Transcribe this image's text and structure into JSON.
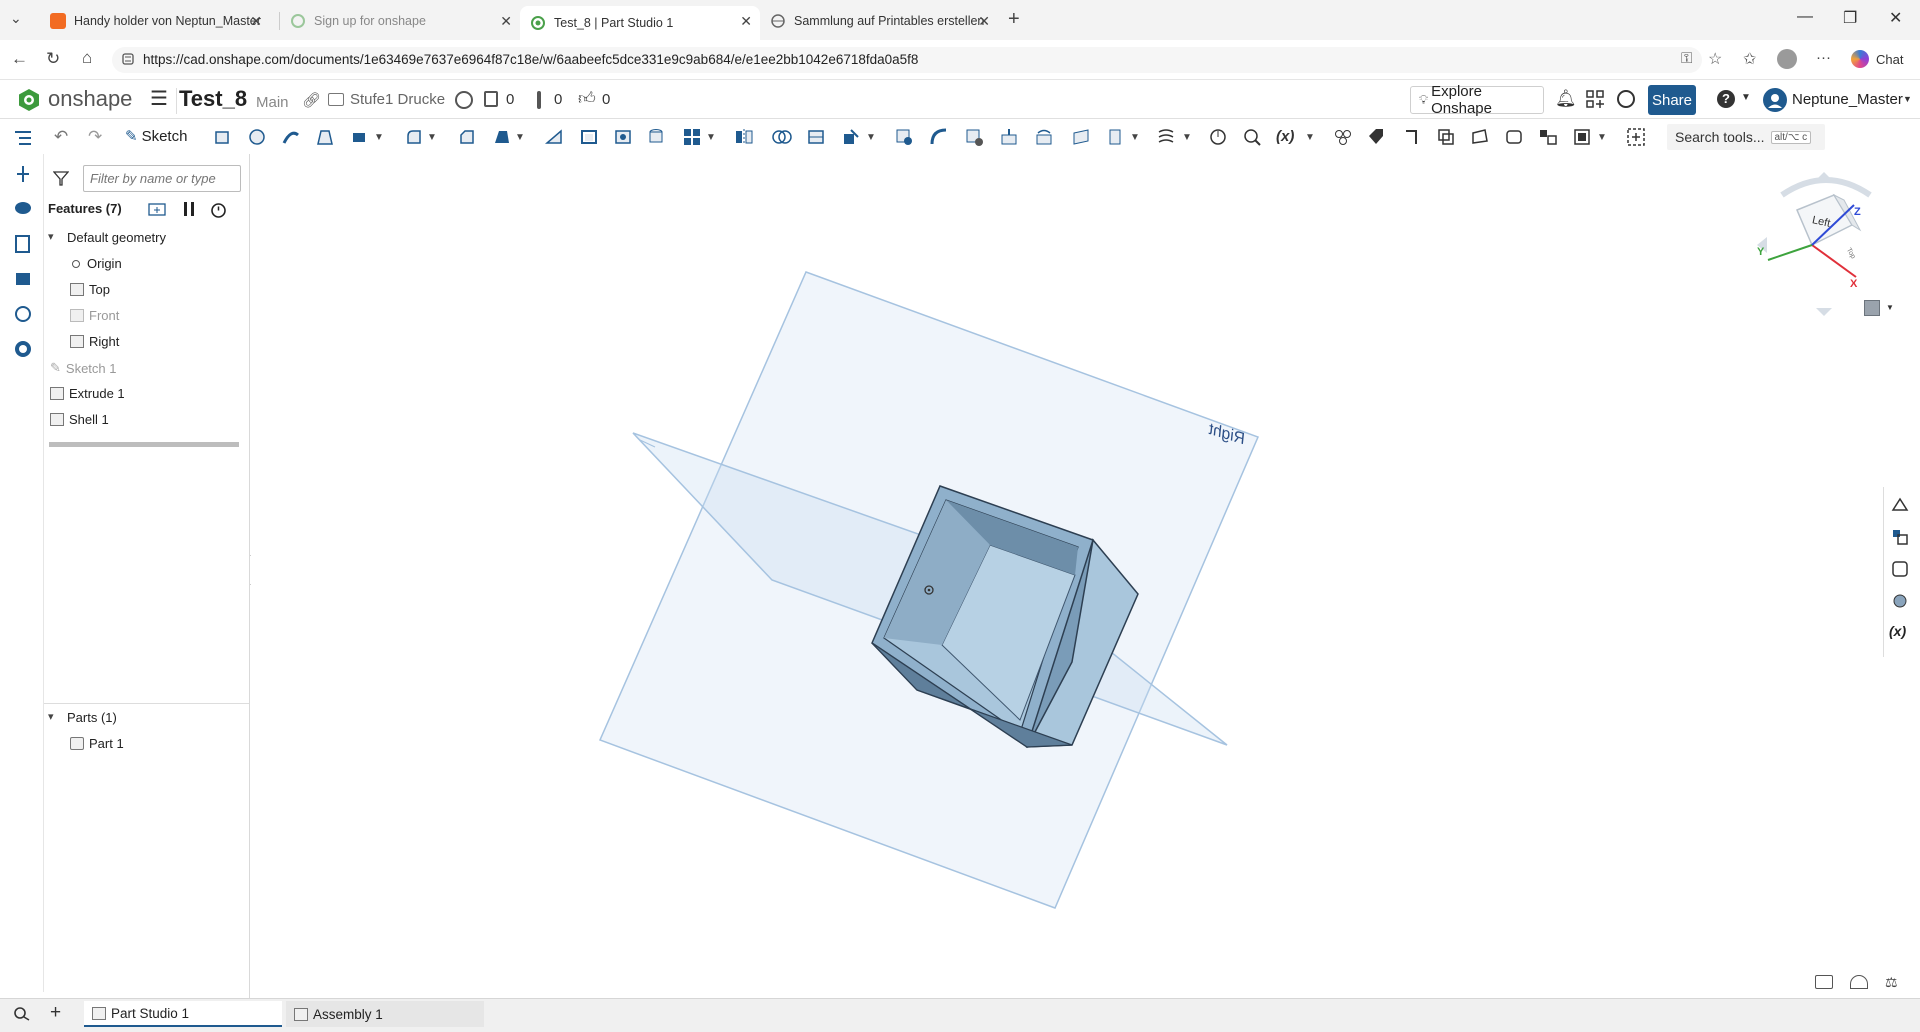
{
  "browser": {
    "tabs": [
      {
        "title": "Handy holder von Neptun_Master",
        "active": false
      },
      {
        "title": "Sign up for onshape",
        "active": false
      },
      {
        "title": "Test_8 | Part Studio 1",
        "active": true
      },
      {
        "title": "Sammlung auf Printables erstellen",
        "active": false
      }
    ],
    "url": "https://cad.onshape.com/documents/1e63469e7637e6964f87c18e/w/6aabeefc5dce331e9c9ab684/e/e1ee2bb1042e6718fda0a5f8",
    "chat_label": "Chat"
  },
  "app": {
    "brand": "onshape",
    "doc_title": "Test_8",
    "branch": "Main",
    "folder": "Stufe1 Drucke",
    "count_versions": "0",
    "count_branches": "0",
    "count_likes": "0",
    "explore_label": "Explore Onshape",
    "share_label": "Share",
    "help_label": "?",
    "user_name": "Neptune_Master",
    "brand_color": "#1f5a8f"
  },
  "toolbar": {
    "sketch_label": "Sketch",
    "search_label": "Search tools...",
    "search_shortcut": "alt/⌥ c"
  },
  "feature_panel": {
    "filter_placeholder": "Filter by name or type",
    "features_header": "Features (7)",
    "default_geometry": "Default geometry",
    "items": {
      "origin": "Origin",
      "top": "Top",
      "front": "Front",
      "right": "Right",
      "sketch1": "Sketch 1",
      "extrude1": "Extrude 1",
      "shell1": "Shell 1"
    },
    "parts_header": "Parts (1)",
    "part1": "Part 1"
  },
  "viewport": {
    "plane_label": "Right",
    "view_cube_label": "Left",
    "view_cube_side": "Top",
    "axis_x": "X",
    "axis_y": "Y",
    "axis_z": "Z"
  },
  "bottom_tabs": {
    "part_studio": "Part Studio 1",
    "assembly": "Assembly 1"
  }
}
